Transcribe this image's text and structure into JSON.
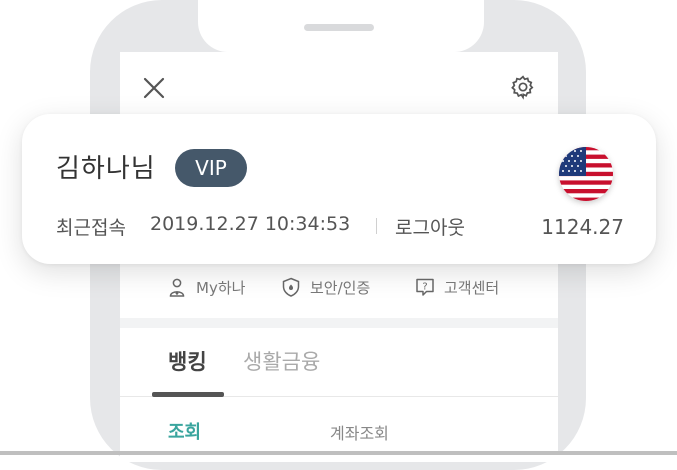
{
  "header": {
    "close_icon": "close-icon",
    "settings_icon": "gear-icon"
  },
  "profile": {
    "user_name": "김하나님",
    "badge": "VIP",
    "last_login_label": "최근접속",
    "last_login_time": "2019.12.27 10:34:53",
    "logout_label": "로그아웃",
    "currency_flag_icon": "us-flag-icon",
    "exchange_rate": "1124.27"
  },
  "quick_links": [
    {
      "icon": "person-icon",
      "label": "My하나"
    },
    {
      "icon": "shield-icon",
      "label": "보안/인증"
    },
    {
      "icon": "question-bubble-icon",
      "label": "고객센터"
    }
  ],
  "tabs": [
    {
      "label": "뱅킹",
      "active": true
    },
    {
      "label": "생활금융",
      "active": false
    }
  ],
  "sub_tabs": [
    {
      "label": "조회",
      "active": true
    },
    {
      "label": "계좌조회",
      "active": false
    }
  ],
  "colors": {
    "badge_bg": "#45586a",
    "accent_teal": "#3aa59e",
    "phone_frame": "#e6e7e9"
  }
}
